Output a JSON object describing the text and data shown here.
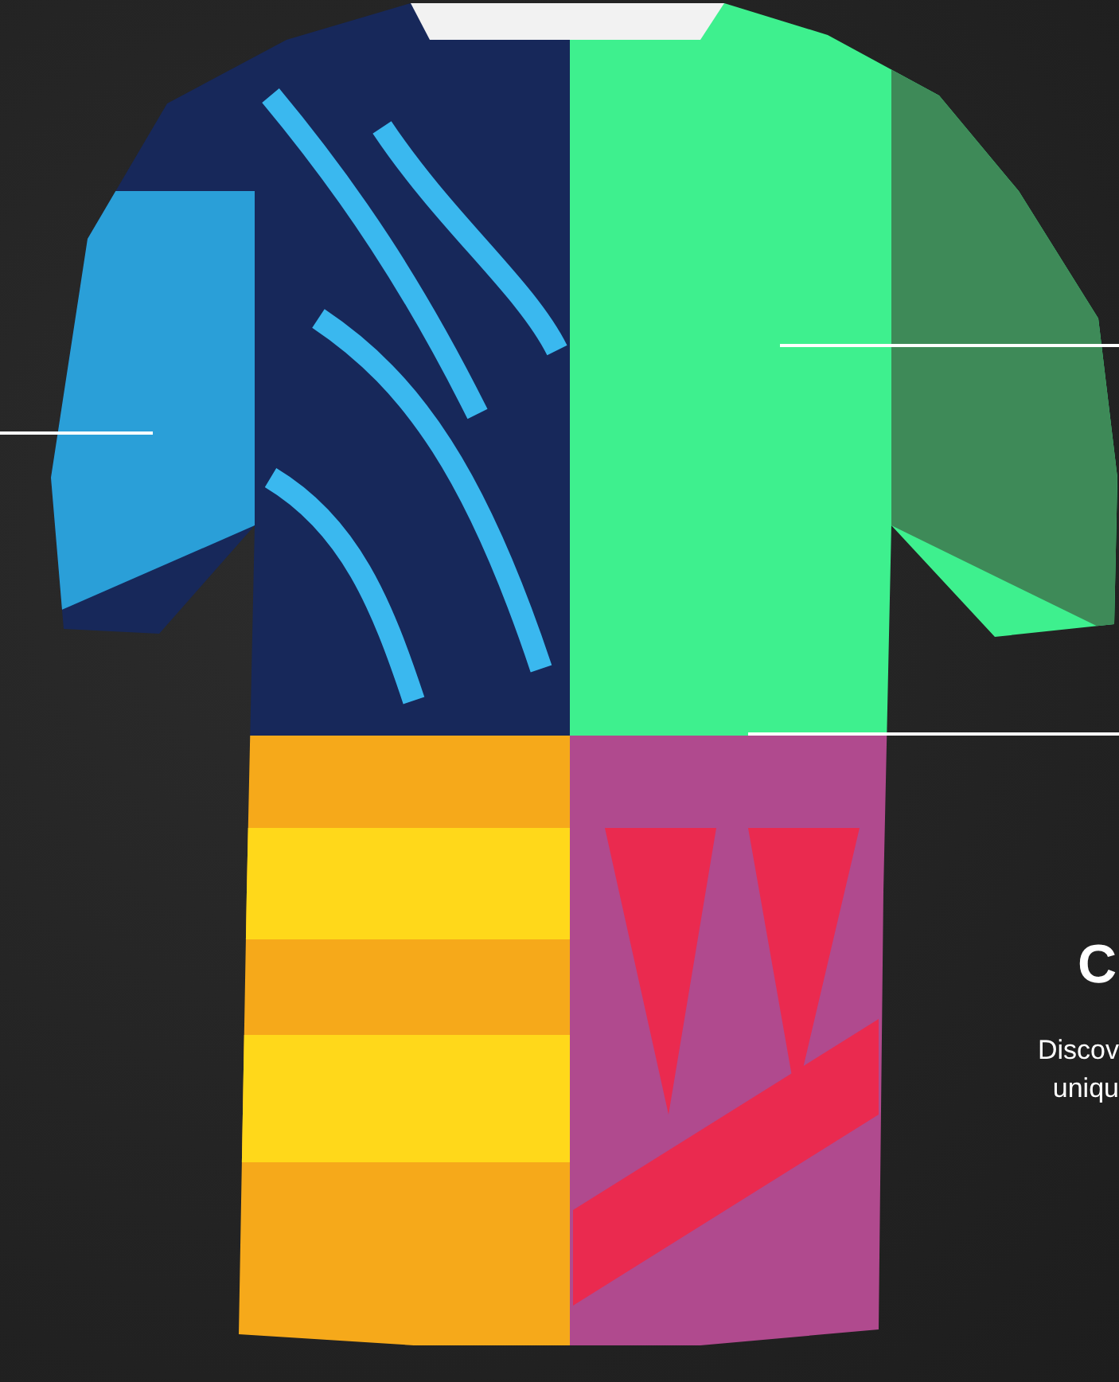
{
  "feature": {
    "heading": "C",
    "description_lines": [
      "Discov",
      "uniqu"
    ]
  }
}
